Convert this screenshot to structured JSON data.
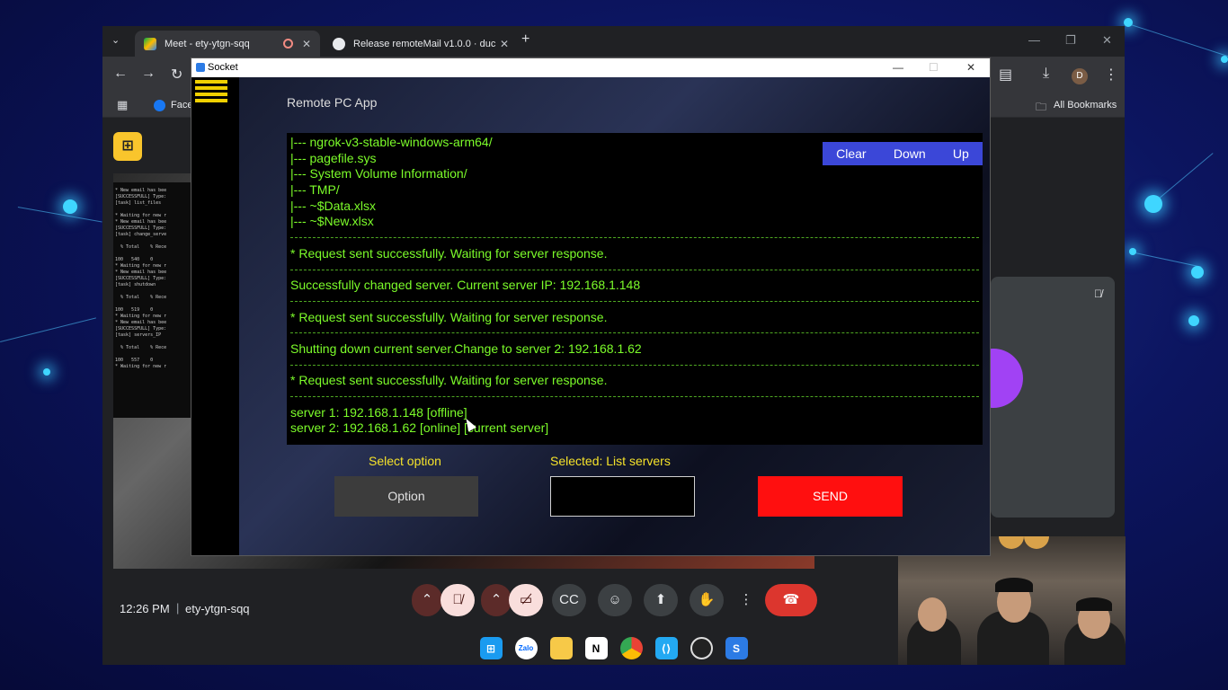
{
  "browser": {
    "tabs": [
      {
        "label": "Meet - ety-ytgn-sqq",
        "active": true
      },
      {
        "label": "Release remoteMail v1.0.0 · duc",
        "active": false
      }
    ],
    "bookmarks": {
      "facebook": "Face",
      "all_bookmarks": "All Bookmarks"
    },
    "profile_initial": "D"
  },
  "meet": {
    "time": "12:26 PM",
    "meeting_code": "ety-ytgn-sqq",
    "shared_console_lines": [
      "* New email has bee",
      "[SUCCESSFULL] Type:",
      "[task] list_files",
      "",
      "* Waiting for new r",
      "* New email has bee",
      "[SUCCESSFULL] Type:",
      "[task] change_serve",
      "",
      "  % Total    % Rece",
      "",
      "100   540    0",
      "* Waiting for new r",
      "* New email has bee",
      "[SUCCESSFULL] Type:",
      "[task] shutdown",
      "",
      "  % Total    % Rece",
      "",
      "100   519    0",
      "* Waiting for new r",
      "* New email has bee",
      "[SUCCESSFULL] Type:",
      "[task] servers_IP",
      "",
      "  % Total    % Rece",
      "",
      "100   557    0",
      "* Waiting for new r"
    ]
  },
  "socket_app": {
    "window_title": "Socket",
    "app_title": "Remote PC App",
    "terminal_buttons": {
      "clear": "Clear",
      "down": "Down",
      "up": "Up"
    },
    "terminal_lines": [
      {
        "type": "text",
        "text": "|--- ngrok-v3-stable-windows-arm64/"
      },
      {
        "type": "text",
        "text": "|--- pagefile.sys"
      },
      {
        "type": "text",
        "text": "|--- System Volume Information/"
      },
      {
        "type": "text",
        "text": "|--- TMP/"
      },
      {
        "type": "text",
        "text": "|--- ~$Data.xlsx"
      },
      {
        "type": "text",
        "text": "|--- ~$New.xlsx"
      },
      {
        "type": "sep",
        "text": ""
      },
      {
        "type": "text",
        "text": "* Request sent successfully. Waiting for server response."
      },
      {
        "type": "sep",
        "text": ""
      },
      {
        "type": "text",
        "text": "Successfully changed server. Current server IP: 192.168.1.148"
      },
      {
        "type": "sep",
        "text": ""
      },
      {
        "type": "text",
        "text": "* Request sent successfully. Waiting for server response."
      },
      {
        "type": "sep",
        "text": ""
      },
      {
        "type": "text",
        "text": "Shutting down current server.Change to server 2: 192.168.1.62"
      },
      {
        "type": "sep",
        "text": ""
      },
      {
        "type": "text",
        "text": "* Request sent successfully. Waiting for server response."
      },
      {
        "type": "sep",
        "text": ""
      },
      {
        "type": "text",
        "text": "server 1: 192.168.1.148 [offline]"
      },
      {
        "type": "text",
        "text": "server 2: 192.168.1.62 [online] [current server]"
      }
    ],
    "select_option_label": "Select option",
    "selected_label": "Selected: List servers",
    "option_button": "Option",
    "input_value": "",
    "send_button": "SEND"
  },
  "colors": {
    "terminal_text": "#7cfc2a",
    "label_yellow": "#f5e22a",
    "send_red": "#ff0f0f",
    "terminal_button_blue": "#3b47d8"
  }
}
